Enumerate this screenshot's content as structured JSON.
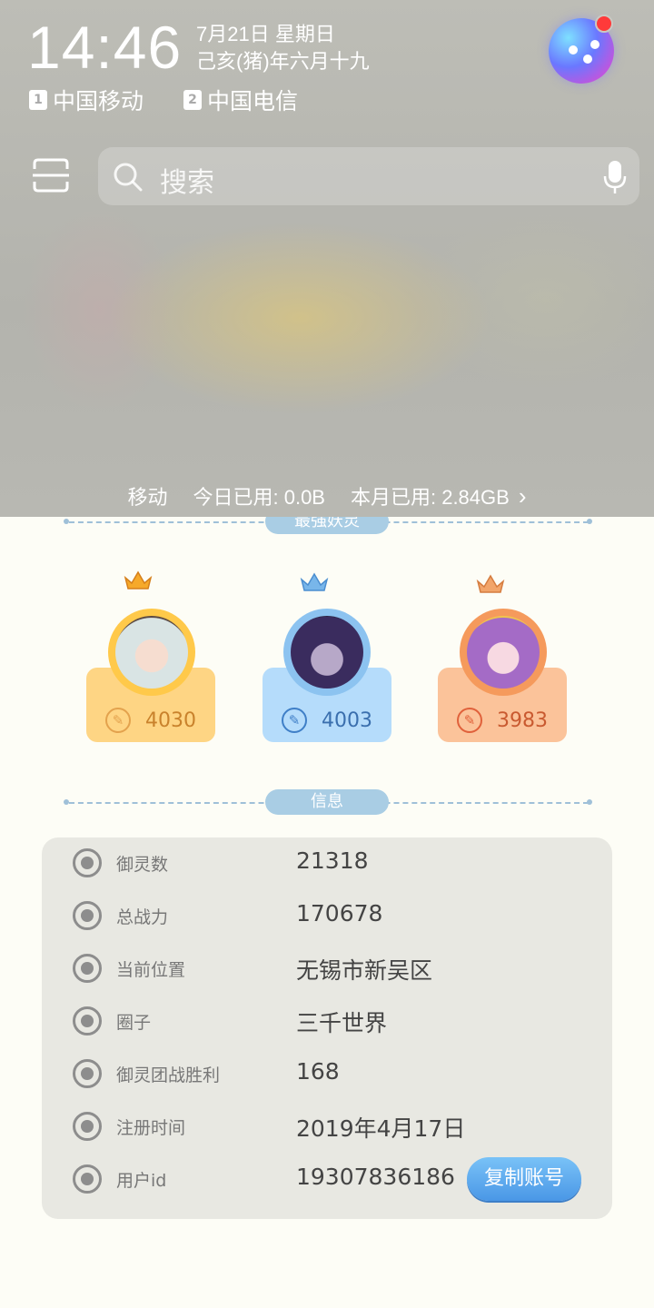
{
  "status": {
    "time": "14:46",
    "date": "7月21日 星期日",
    "lunar_date": "己亥(猪)年六月十九",
    "sim1_badge": "1",
    "sim1_carrier": "中国移动",
    "sim2_badge": "2",
    "sim2_carrier": "中国电信"
  },
  "search": {
    "placeholder": "搜索"
  },
  "data_usage": {
    "carrier": "移动",
    "today": "今日已用: 0.0B",
    "month": "本月已用: 2.84GB",
    "chevron": "›"
  },
  "ranking": {
    "section_title": "最强妖灵",
    "entries": [
      {
        "score": "4030"
      },
      {
        "score": "4003"
      },
      {
        "score": "3983"
      }
    ]
  },
  "info": {
    "section_title": "信息",
    "rows": [
      {
        "label": "御灵数",
        "value": "21318"
      },
      {
        "label": "总战力",
        "value": "170678"
      },
      {
        "label": "当前位置",
        "value": "无锡市新吴区"
      },
      {
        "label": "圈子",
        "value": "三千世界"
      },
      {
        "label": "御灵团战胜利",
        "value": "168"
      },
      {
        "label": "注册时间",
        "value": "2019年4月17日"
      },
      {
        "label": "用户id",
        "value": "19307836186"
      }
    ],
    "copy_button": "复制账号"
  },
  "colors": {
    "gold_card": "#fed584",
    "blue_card": "#b5dcfb",
    "orange_card": "#fbc39a",
    "button_blue": "#4a97e6"
  }
}
